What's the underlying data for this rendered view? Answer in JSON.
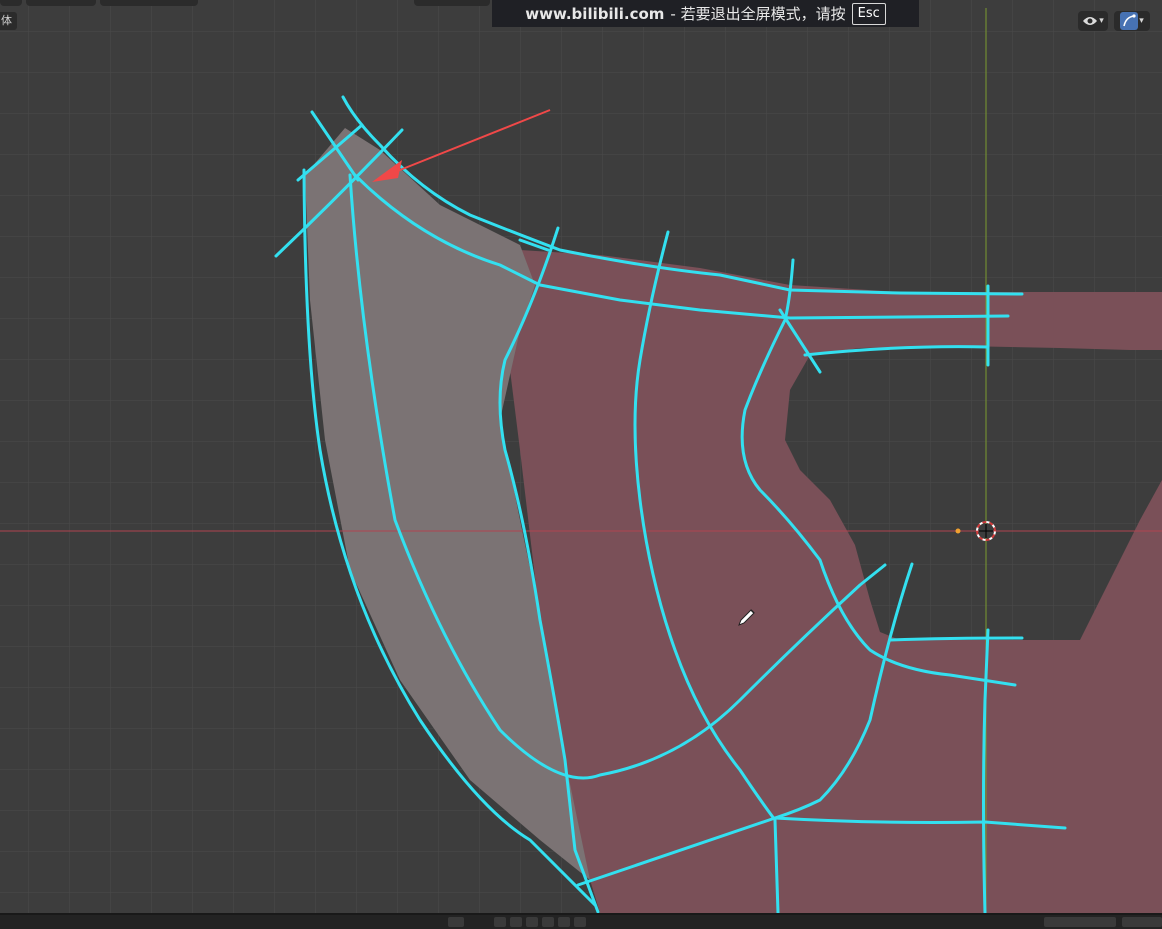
{
  "banner": {
    "url": "www.bilibili.com",
    "message": "- 若要退出全屏模式，请按",
    "key": "Esc"
  },
  "header": {
    "mode_label": "体",
    "visibility_icon": "eye-icon",
    "gizmo_icon": "gizmo-icon"
  },
  "colors": {
    "viewport_bg": "#3d3d3d",
    "grid_line": "#4a4a4a",
    "x_axis": "#b0434f",
    "y_axis": "#7a9a2e",
    "mesh_pink": "#7a5058",
    "mesh_gray": "#7b7374",
    "stroke_cyan": "#33e0f0",
    "arrow_red": "#f04848"
  },
  "icons": {
    "cursor": "pencil-cursor-icon",
    "origin": "3d-cursor-icon",
    "playback": [
      "jump-start-icon",
      "prev-key-icon",
      "play-reverse-icon",
      "play-icon",
      "next-key-icon",
      "jump-end-icon"
    ]
  }
}
